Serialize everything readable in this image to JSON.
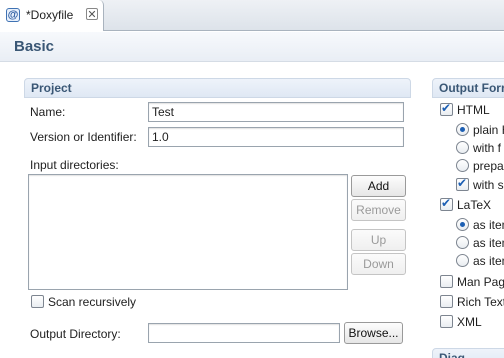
{
  "tab": {
    "title": "*Doxyfile",
    "icon": "doxyfile-icon",
    "close_icon": "close-icon"
  },
  "page": {
    "title": "Basic"
  },
  "project": {
    "heading": "Project",
    "name_label": "Name:",
    "name_value": "Test",
    "version_label": "Version or Identifier:",
    "version_value": "1.0",
    "input_dirs_label": "Input directories:",
    "buttons": {
      "add": "Add",
      "remove": "Remove",
      "up": "Up",
      "down": "Down"
    },
    "scan_recursively_label": "Scan recursively",
    "scan_recursively_checked": false,
    "output_dir_label": "Output Directory:",
    "output_dir_value": "",
    "browse_label": "Browse..."
  },
  "output_formats": {
    "heading": "Output Forr",
    "html": {
      "label": "HTML",
      "checked": true
    },
    "html_options": [
      {
        "label": "plain H",
        "type": "radio",
        "selected": true
      },
      {
        "label": "with f",
        "type": "radio",
        "selected": false
      },
      {
        "label": "prepa",
        "type": "radio",
        "selected": false
      },
      {
        "label": "with s",
        "type": "checkbox",
        "checked": true
      }
    ],
    "latex": {
      "label": "LaTeX",
      "checked": true
    },
    "latex_options": [
      {
        "label": "as iten",
        "selected": true
      },
      {
        "label": "as iten",
        "selected": false
      },
      {
        "label": "as iten",
        "selected": false
      }
    ],
    "man_pages": {
      "label": "Man Page",
      "checked": false
    },
    "rich_text": {
      "label": "Rich Text",
      "checked": false
    },
    "xml": {
      "label": "XML",
      "checked": false
    }
  },
  "next_section": {
    "heading": "Diag"
  },
  "colors": {
    "accent": "#1d5fb3",
    "section_title": "#3a5775"
  }
}
